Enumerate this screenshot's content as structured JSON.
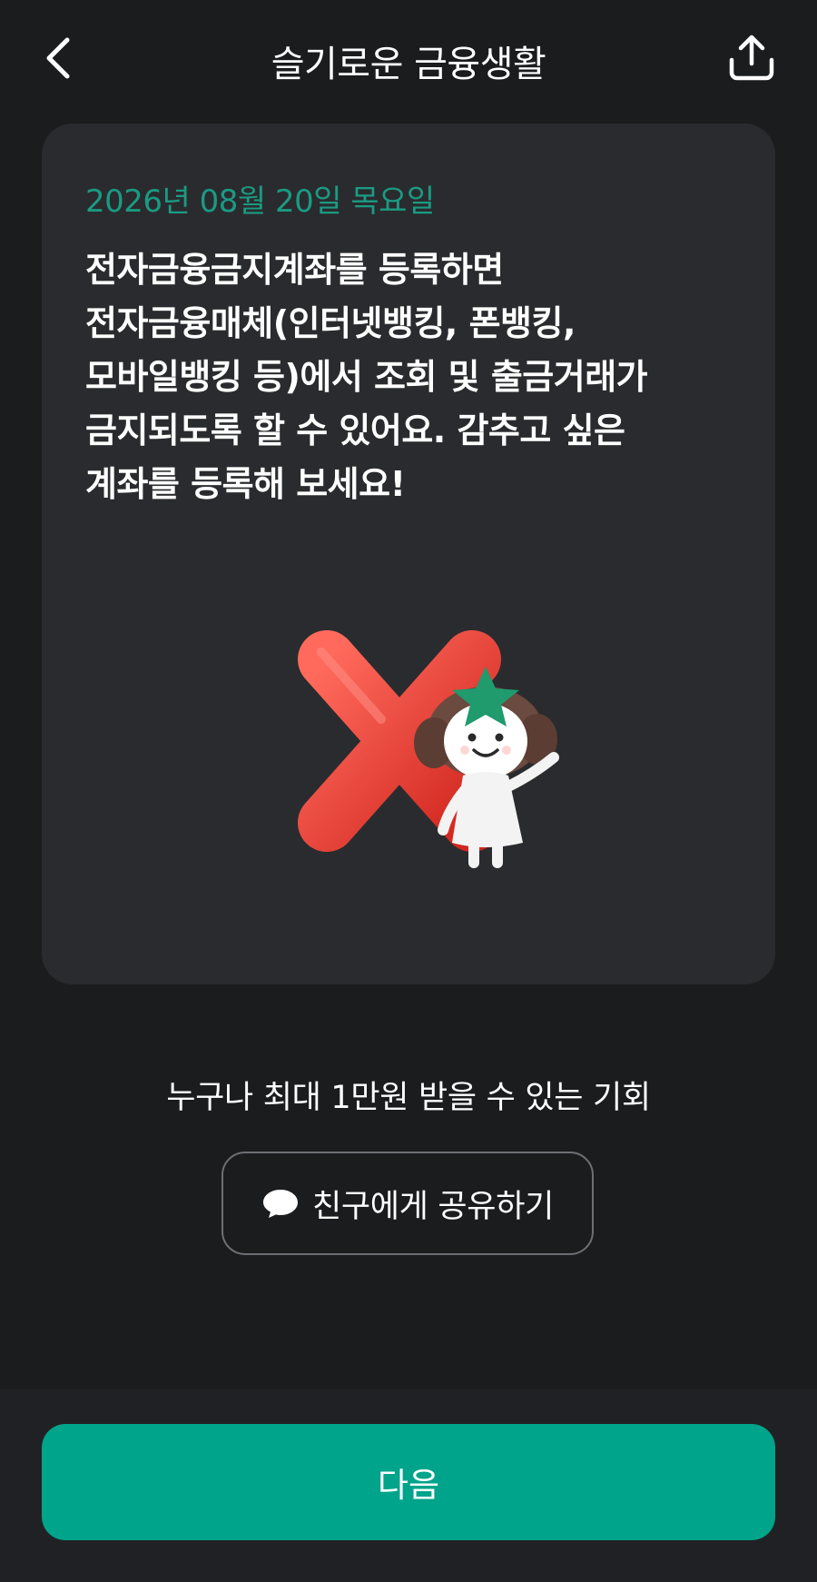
{
  "header": {
    "title": "슬기로운 금융생활",
    "back_icon": "chevron-left-icon",
    "share_icon": "share-upload-icon"
  },
  "card": {
    "date": "2026년 08월 20일 목요일",
    "body_lines": [
      "전자금융금지계좌를 등록하면",
      "전자금융매체(인터넷뱅킹, 폰뱅킹,",
      "모바일뱅킹 등)에서 조회 및 출금거래가",
      "금지되도록 할 수 있어요. 감추고 싶은",
      "계좌를 등록해 보세요!"
    ],
    "illustration": "red-x-with-mascot"
  },
  "promo": {
    "text": "누구나 최대 1만원 받을 수 있는 기회"
  },
  "share_friend": {
    "icon": "chat-bubble-icon",
    "label": "친구에게 공유하기"
  },
  "footer": {
    "next_label": "다음"
  },
  "colors": {
    "background": "#1b1c1e",
    "card": "#2a2b2e",
    "accent_green": "#00a48a",
    "date_green": "#1a9b82"
  }
}
